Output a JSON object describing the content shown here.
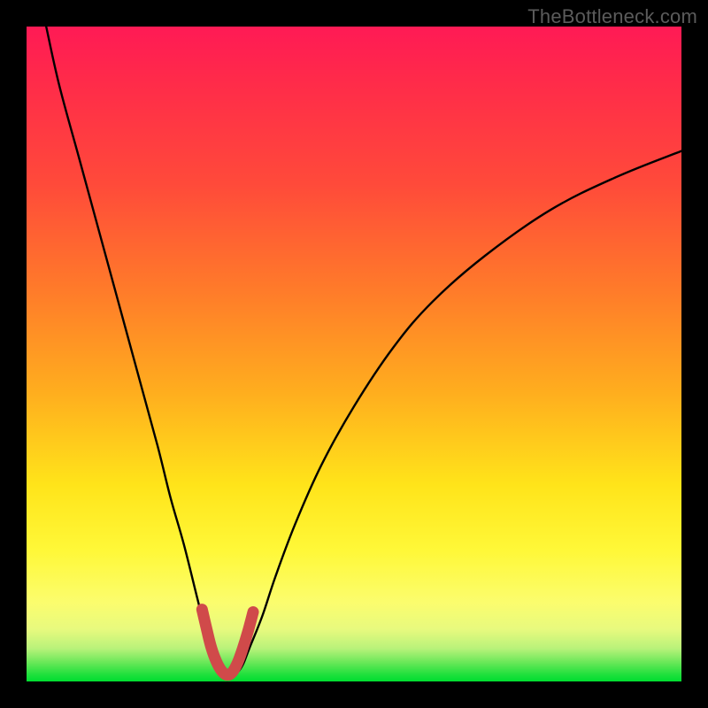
{
  "watermark": {
    "text": "TheBottleneck.com"
  },
  "colors": {
    "background": "#000000",
    "gradient_top": "#ff1a55",
    "gradient_mid": "#ffe41a",
    "gradient_bottom": "#00dd30",
    "curve": "#000000",
    "highlight": "#d04a4a"
  },
  "chart_data": {
    "type": "line",
    "title": "",
    "xlabel": "",
    "ylabel": "",
    "xlim": [
      0,
      100
    ],
    "ylim": [
      0,
      100
    ],
    "series": [
      {
        "name": "bottleneck-curve",
        "x": [
          3,
          5,
          8,
          11,
          14,
          17,
          20,
          22,
          24,
          26,
          27,
          28,
          29,
          30,
          31,
          32,
          33,
          34,
          36,
          38,
          41,
          45,
          50,
          56,
          62,
          70,
          80,
          90,
          100
        ],
        "values": [
          100,
          91,
          80,
          69,
          58,
          47,
          36,
          28,
          21,
          13,
          9,
          5,
          2.5,
          1.2,
          1.0,
          1.2,
          2.5,
          5,
          10,
          16,
          24,
          33,
          42,
          51,
          58,
          65,
          72,
          77,
          81
        ]
      },
      {
        "name": "curve-highlight-near-minimum",
        "x": [
          26.8,
          27.5,
          28.2,
          29.0,
          29.8,
          30.6,
          31.4,
          32.2,
          33.0,
          33.8,
          34.6
        ],
        "values": [
          11.0,
          8.0,
          5.2,
          3.0,
          1.6,
          1.0,
          1.4,
          2.8,
          5.0,
          7.6,
          10.6
        ]
      }
    ],
    "annotations": []
  }
}
